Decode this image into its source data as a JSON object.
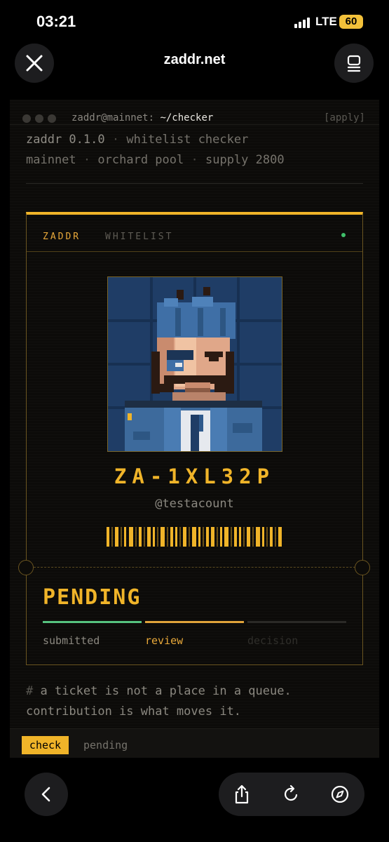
{
  "status_bar": {
    "time": "03:21",
    "network": "LTE",
    "battery": "60"
  },
  "browser": {
    "url": "zaddr.net"
  },
  "terminal": {
    "host": "zaddr@mainnet:",
    "path": "~/checker",
    "action": "[apply]"
  },
  "meta": {
    "line1": [
      "zaddr 0.1.0",
      "whitelist checker"
    ],
    "line2": [
      "mainnet",
      "orchard pool",
      "supply 2800"
    ],
    "separator": "·"
  },
  "ticket": {
    "brand": "ZADDR",
    "tag": "WHITELIST",
    "id": "ZA-1XL32P",
    "handle": "@testacount",
    "state": "PENDING",
    "steps": [
      {
        "label": "submitted",
        "status": "done"
      },
      {
        "label": "review",
        "status": "active"
      },
      {
        "label": "decision",
        "status": "upcoming"
      }
    ]
  },
  "note": {
    "hash": "#",
    "line1": "a ticket is not a place in a queue.",
    "line2": "contribution is what moves it."
  },
  "bottom": {
    "check_label": "check",
    "status_label": "pending"
  },
  "colors": {
    "accent": "#f0b429",
    "done": "#56c27f",
    "upcoming": "#2b2a27"
  },
  "icons": [
    "close-icon",
    "tabs-icon",
    "back-icon",
    "share-icon",
    "reload-icon",
    "compass-icon"
  ]
}
